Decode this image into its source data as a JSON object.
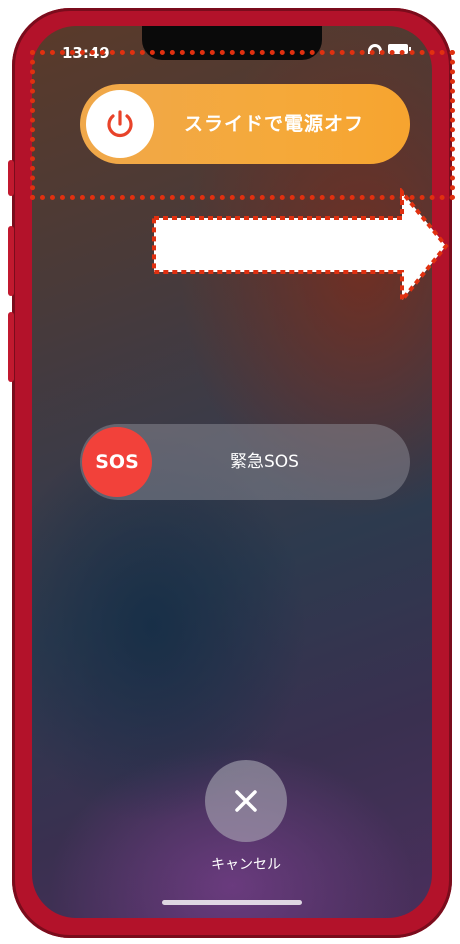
{
  "status_bar": {
    "time": "13:49"
  },
  "power_slider": {
    "label": "スライドで電源オフ",
    "knob_icon": "power-icon"
  },
  "sos_slider": {
    "knob_label": "SOS",
    "label": "緊急SOS"
  },
  "cancel": {
    "label": "キャンセル",
    "icon": "close-icon"
  },
  "colors": {
    "frame": "#b3122a",
    "power_slider": "#f5a93a",
    "power_icon": "#e8432a",
    "sos_knob": "#f2413a",
    "annotation": "#e03010"
  }
}
